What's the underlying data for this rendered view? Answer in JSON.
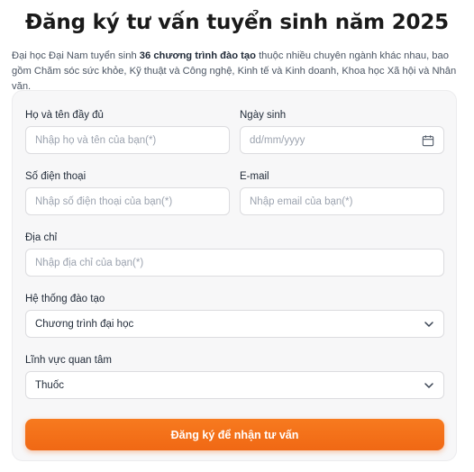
{
  "page": {
    "title": "Đăng ký tư vấn tuyển sinh năm 2025",
    "intro_prefix": "Đại học Đại Nam tuyển sinh ",
    "intro_bold": "36 chương trình đào tạo",
    "intro_suffix": " thuộc nhiều chuyên ngành khác nhau, bao gồm Chăm sóc sức khỏe, Kỹ thuật và Công nghệ, Kinh tế và Kinh doanh, Khoa học Xã hội và Nhân văn."
  },
  "form": {
    "fullname": {
      "label": "Họ và tên đầy đủ",
      "placeholder": "Nhập họ và tên của bạn(*)"
    },
    "dob": {
      "label": "Ngày sinh",
      "placeholder": "dd/mm/yyyy",
      "icon": "calendar-icon"
    },
    "phone": {
      "label": "Số điện thoại",
      "placeholder": "Nhập số điện thoại của bạn(*)"
    },
    "email": {
      "label": "E-mail",
      "placeholder": "Nhập email của bạn(*)"
    },
    "address": {
      "label": "Địa chỉ",
      "placeholder": "Nhập địa chỉ của bạn(*)"
    },
    "program": {
      "label": "Hệ thống đào tạo",
      "value": "Chương trình đại học",
      "icon": "chevron-down-icon"
    },
    "interest": {
      "label": "Lĩnh vực quan tâm",
      "value": "Thuốc",
      "icon": "chevron-down-icon"
    },
    "submit_label": "Đăng ký để nhận tư vấn"
  },
  "colors": {
    "accent": "#f26e16",
    "card_bg": "#f7f7f8",
    "title": "#1a1a1a"
  }
}
